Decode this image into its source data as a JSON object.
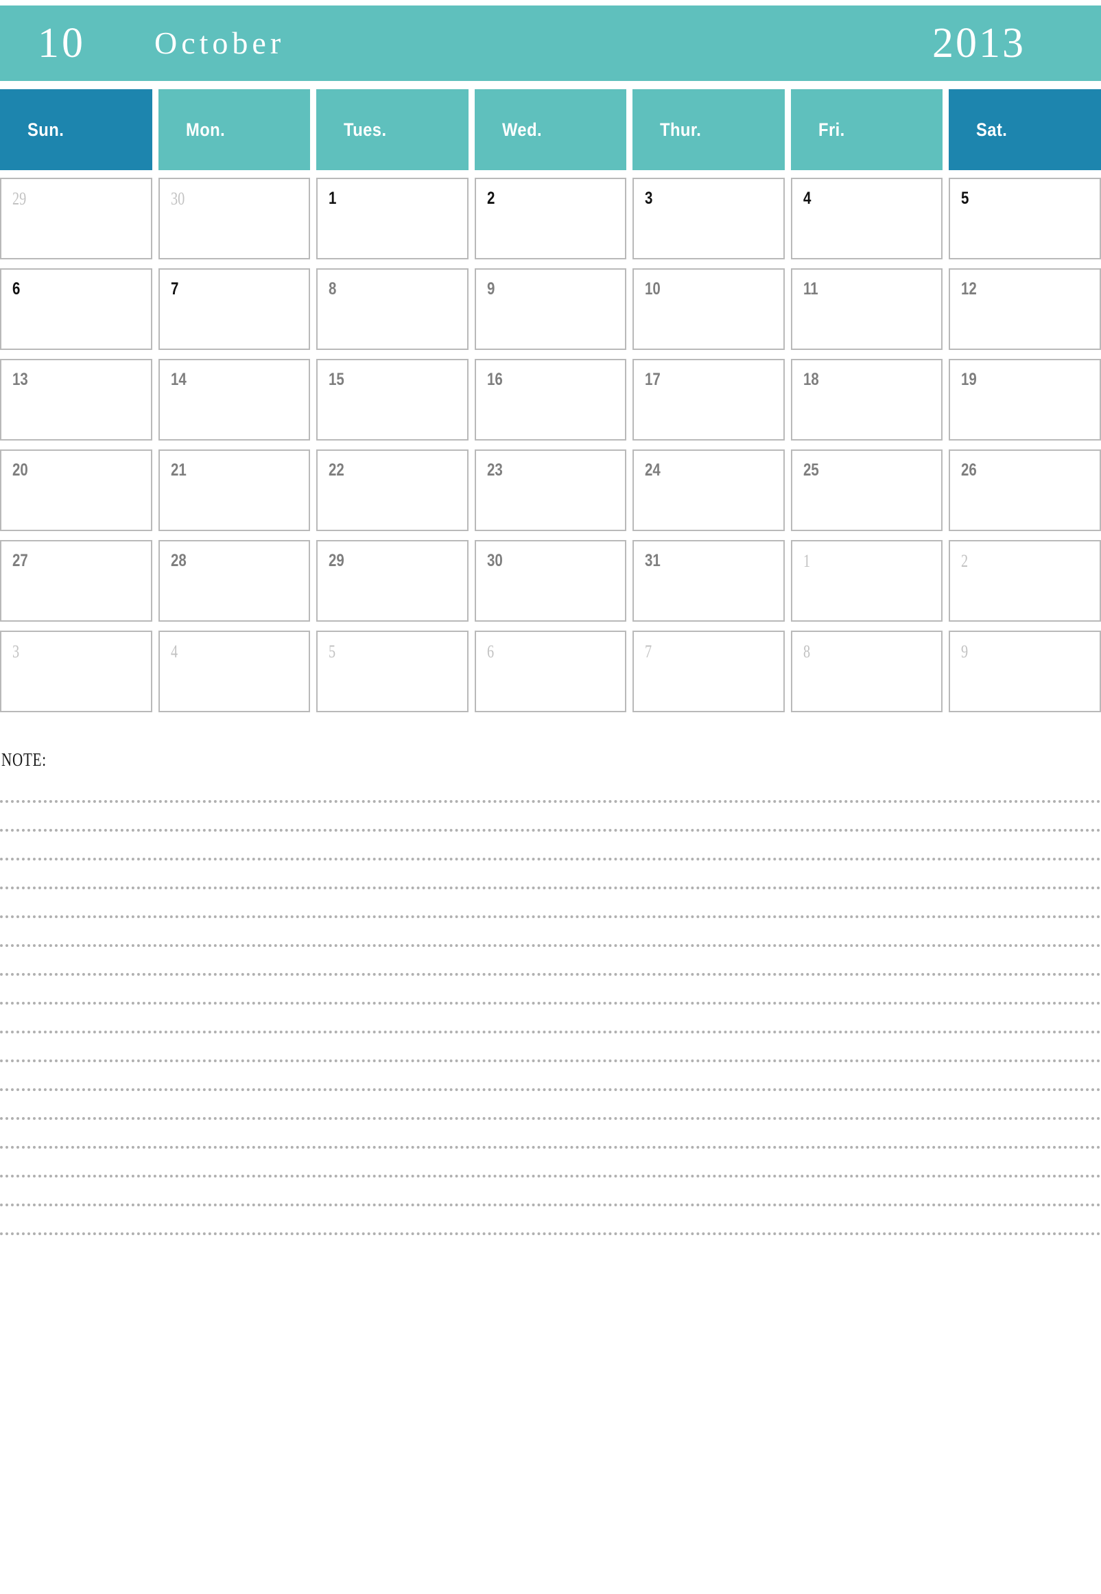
{
  "header": {
    "month_number": "10",
    "month_name": "October",
    "year": "2013",
    "banner_color": "#5fc0bd",
    "text_color": "#ffffff"
  },
  "weekdays": [
    {
      "label": "Sun.",
      "weekend": true,
      "color": "#1d85ae"
    },
    {
      "label": "Mon.",
      "weekend": false,
      "color": "#5fc0bd"
    },
    {
      "label": "Tues.",
      "weekend": false,
      "color": "#5fc0bd"
    },
    {
      "label": "Wed.",
      "weekend": false,
      "color": "#5fc0bd"
    },
    {
      "label": "Thur.",
      "weekend": false,
      "color": "#5fc0bd"
    },
    {
      "label": "Fri.",
      "weekend": false,
      "color": "#5fc0bd"
    },
    {
      "label": "Sat.",
      "weekend": true,
      "color": "#1d85ae"
    }
  ],
  "weeks": [
    [
      {
        "day": "29",
        "style": "muted"
      },
      {
        "day": "30",
        "style": "muted"
      },
      {
        "day": "1",
        "style": "strong"
      },
      {
        "day": "2",
        "style": "strong"
      },
      {
        "day": "3",
        "style": "strong"
      },
      {
        "day": "4",
        "style": "strong"
      },
      {
        "day": "5",
        "style": "strong"
      }
    ],
    [
      {
        "day": "6",
        "style": "strong"
      },
      {
        "day": "7",
        "style": "strong"
      },
      {
        "day": "8",
        "style": "normal"
      },
      {
        "day": "9",
        "style": "normal"
      },
      {
        "day": "10",
        "style": "normal"
      },
      {
        "day": "11",
        "style": "normal"
      },
      {
        "day": "12",
        "style": "normal"
      }
    ],
    [
      {
        "day": "13",
        "style": "normal"
      },
      {
        "day": "14",
        "style": "normal"
      },
      {
        "day": "15",
        "style": "normal"
      },
      {
        "day": "16",
        "style": "normal"
      },
      {
        "day": "17",
        "style": "normal"
      },
      {
        "day": "18",
        "style": "normal"
      },
      {
        "day": "19",
        "style": "normal"
      }
    ],
    [
      {
        "day": "20",
        "style": "normal"
      },
      {
        "day": "21",
        "style": "normal"
      },
      {
        "day": "22",
        "style": "normal"
      },
      {
        "day": "23",
        "style": "normal"
      },
      {
        "day": "24",
        "style": "normal"
      },
      {
        "day": "25",
        "style": "normal"
      },
      {
        "day": "26",
        "style": "normal"
      }
    ],
    [
      {
        "day": "27",
        "style": "normal"
      },
      {
        "day": "28",
        "style": "normal"
      },
      {
        "day": "29",
        "style": "normal"
      },
      {
        "day": "30",
        "style": "normal"
      },
      {
        "day": "31",
        "style": "normal"
      },
      {
        "day": "1",
        "style": "muted"
      },
      {
        "day": "2",
        "style": "muted"
      }
    ],
    [
      {
        "day": "3",
        "style": "muted"
      },
      {
        "day": "4",
        "style": "muted"
      },
      {
        "day": "5",
        "style": "muted"
      },
      {
        "day": "6",
        "style": "muted"
      },
      {
        "day": "7",
        "style": "muted"
      },
      {
        "day": "8",
        "style": "muted"
      },
      {
        "day": "9",
        "style": "muted"
      }
    ]
  ],
  "note": {
    "label": "NOTE:",
    "line_count": 16,
    "line_color": "#b0b0b0"
  },
  "colors": {
    "teal": "#5fc0bd",
    "deep_blue": "#1d85ae",
    "cell_border": "#b9b9b9",
    "day_strong": "#111111",
    "day_normal": "#7e7e7e",
    "day_muted": "#c2c2c2"
  }
}
